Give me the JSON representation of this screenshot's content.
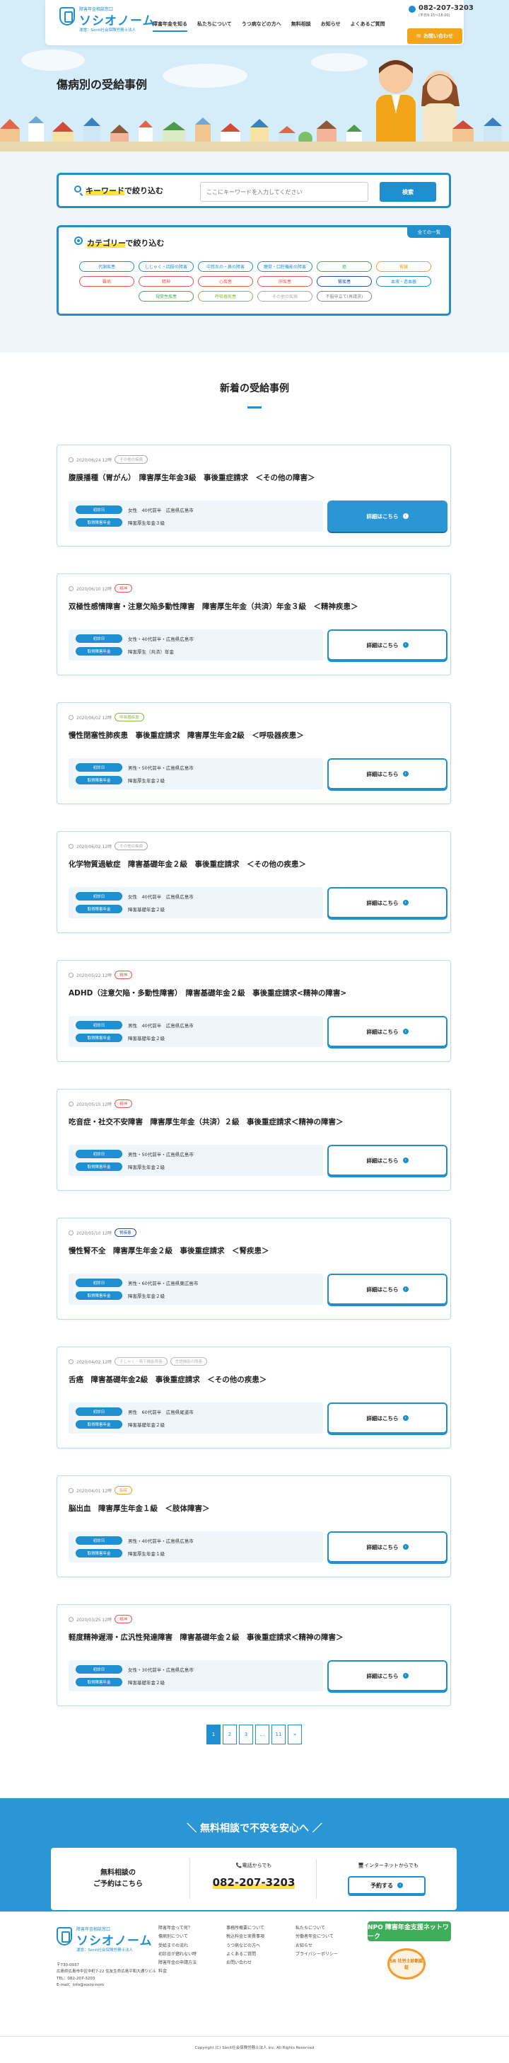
{
  "header": {
    "logo_small": "障害年金相談窓口",
    "logo_big": "ソシオノーム",
    "logo_sub": "運営：Sonit社会保険労務士法人",
    "nav": [
      "障害年金を知る",
      "私たちについて",
      "うつ病などの方へ",
      "無料相談",
      "お知らせ",
      "よくあるご質問"
    ],
    "tel": "082-207-3203",
    "tel_hours": "(平日9:15〜18:00)",
    "inquiry": "お問い合わせ"
  },
  "page_title": "傷病別の受給事例",
  "search": {
    "keyword_prefix": "キーワード",
    "keyword_suffix": "で絞り込む",
    "placeholder": "ここにキーワードを入力してください",
    "button": "検索",
    "category_prefix": "カテゴリー",
    "category_suffix": "で絞り込む",
    "all_button": "全ての一覧",
    "tags": [
      {
        "label": "代謝疾患",
        "color": "#1f8fd0"
      },
      {
        "label": "しじゃく・四肢の障害",
        "color": "#1f8fd0"
      },
      {
        "label": "中耳炎の・鼻の障害",
        "color": "#1f8fd0"
      },
      {
        "label": "聴覚・口腔機能の障害",
        "color": "#1f8fd0"
      },
      {
        "label": "癌",
        "color": "#3fae5a"
      },
      {
        "label": "腎臓",
        "color": "#f39c2a"
      },
      {
        "label": "難病",
        "color": "#e8584f"
      },
      {
        "label": "精神",
        "color": "#e8584f"
      },
      {
        "label": "心疾患",
        "color": "#e8584f"
      },
      {
        "label": "肝疾患",
        "color": "#e8584f"
      },
      {
        "label": "腎疾患",
        "color": "#1f4fa8"
      },
      {
        "label": "血液・造血器",
        "color": "#1f8fd0"
      },
      {
        "label": "視覚性疾患",
        "color": "#3fae5a"
      },
      {
        "label": "呼吸器疾患",
        "color": "#8ab83c"
      },
      {
        "label": "その他の疾病",
        "color": "#aaaaaa"
      },
      {
        "label": "不服申立て(再請求)",
        "color": "#888888"
      }
    ]
  },
  "news": {
    "title": "新着の受給事例",
    "detail_label": "詳細はこちら",
    "badge_gender_age": "初診日",
    "badge_grade": "取得障害年金",
    "cards": [
      {
        "date": "2020/06/24 12時",
        "tags": [
          {
            "label": "その他の疾病",
            "color": "#aaaaaa"
          }
        ],
        "title": "腹膜播種（胃がん）　障害厚生年金3級　事後重症請求　＜その他の障害＞",
        "info1": "女性　40代前半　広島県広島市",
        "info2": "障害厚生年金３級",
        "filled": true
      },
      {
        "date": "2020/06/10 12時",
        "tags": [
          {
            "label": "精神",
            "color": "#e8584f"
          }
        ],
        "title": "双極性感情障害・注意欠陥多動性障害　障害厚生年金（共済）年金３級　＜精神疾患＞",
        "info1": "女性・40代前半・広島県広島市",
        "info2": "障害厚生（共済）年金",
        "filled": false
      },
      {
        "date": "2020/06/02 12時",
        "tags": [
          {
            "label": "呼吸器疾患",
            "color": "#8ab83c"
          }
        ],
        "title": "慢性閉塞性肺疾患　事後重症請求　障害厚生年金2級　＜呼吸器疾患＞",
        "info1": "男性・50代前半・広島県広島市",
        "info2": "障害厚生年金２級",
        "filled": false
      },
      {
        "date": "2020/06/02 12時",
        "tags": [
          {
            "label": "その他の疾病",
            "color": "#aaaaaa"
          }
        ],
        "title": "化学物質過敏症　障害基礎年金２級　事後重症請求　＜その他の疾患＞",
        "info1": "女性　40代前半　広島県広島市",
        "info2": "障害基礎年金２級",
        "filled": false
      },
      {
        "date": "2020/05/22 12時",
        "tags": [
          {
            "label": "精神",
            "color": "#e8584f"
          }
        ],
        "title": "ADHD（注意欠陥・多動性障害）　障害基礎年金２級　事後重症請求<精神の障害>",
        "info1": "男性　40代前半　広島県広島市",
        "info2": "障害基礎年金２級",
        "filled": false
      },
      {
        "date": "2020/05/15 12時",
        "tags": [
          {
            "label": "精神",
            "color": "#e8584f"
          }
        ],
        "title": "吃音症・社交不安障害　障害厚生年金（共済）２級　事後重症請求＜精神の障害＞",
        "info1": "男性・50代前半・広島県広島市",
        "info2": "障害厚生年金２級",
        "filled": false
      },
      {
        "date": "2020/05/10 12時",
        "tags": [
          {
            "label": "腎疾患",
            "color": "#1f4fa8"
          }
        ],
        "title": "慢性腎不全　障害厚生年金２級　事後重症請求　＜腎疾患＞",
        "info1": "男性・60代前半・広島県東広島市",
        "info2": "障害厚生年金２級",
        "filled": false
      },
      {
        "date": "2020/04/02 12時",
        "tags": [
          {
            "label": "そしゃく・嚥下機能障害",
            "color": "#bbbbbb"
          },
          {
            "label": "言語機能の障害",
            "color": "#bbbbbb"
          }
        ],
        "title": "舌癌　障害基礎年金2級　事後重症請求　＜その他の疾患＞",
        "info1": "男性　60代前半　広島県尾道市",
        "info2": "障害基礎年金２級",
        "filled": false
      },
      {
        "date": "2020/04/01 12時",
        "tags": [
          {
            "label": "脳疾",
            "color": "#f39c2a"
          }
        ],
        "title": "脳出血　障害厚生年金１級　＜肢体障害＞",
        "info1": "男性・40代前半・広島県広島市",
        "info2": "障害厚生年金１級",
        "filled": false
      },
      {
        "date": "2020/03/25 12時",
        "tags": [
          {
            "label": "精神",
            "color": "#e8584f"
          }
        ],
        "title": "軽度精神遅滞・広汎性発達障害　障害基礎年金２級　事後重症請求＜精神の障害＞",
        "info1": "女性・30代前半・広島県広島市",
        "info2": "障害基礎年金２級",
        "filled": false
      }
    ]
  },
  "pager": [
    "1",
    "2",
    "3",
    "…",
    "11",
    "»"
  ],
  "cta": {
    "title": "＼ 無料相談で不安を安心へ ／",
    "left_line1": "無料相談の",
    "left_line2": "ご予約はこちら",
    "tel_label": "📞電話からでも",
    "tel": "082-207-3203",
    "web_label": "🖥インターネットからでも",
    "button": "予約する"
  },
  "footer": {
    "addr": [
      "〒730-0037",
      "広島県広島市中区中町7-22 住友生命広島平和大通りビル",
      "TEL：082-207-3203",
      "E-mail：info@socio-nom"
    ],
    "col1": [
      "障害年金って何？",
      "傷病別について",
      "受給までの流れ",
      "初診日が遡れない時",
      "障害年金の申請方法",
      "料金"
    ],
    "col2": [
      "事務所概要について",
      "税込料金と実費事項",
      "うつ病などの方へ",
      "よくあるご質問",
      "お問い合わせ"
    ],
    "col3": [
      "私たちについて",
      "労働者年金について",
      "お知らせ",
      "プライバシーポリシー"
    ],
    "badge1": "NPO 障害年金支援ネットワーク",
    "badge2": "SR 社労士診断認証",
    "copy": "Copyright (C) Sonit社会保険労務士法人 Inc. All Rights Reserved"
  }
}
